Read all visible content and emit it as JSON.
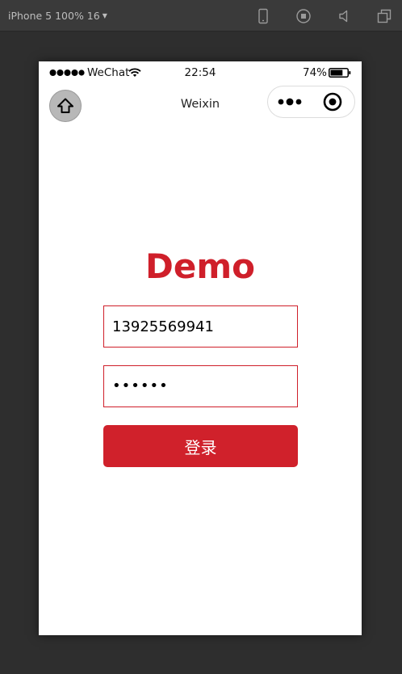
{
  "simulator": {
    "device_label": "iPhone 5 100% 16",
    "toolbar_icons": [
      "phone-icon",
      "record-icon",
      "speaker-icon",
      "windows-icon"
    ]
  },
  "statusbar": {
    "carrier": "WeChat",
    "time": "22:54",
    "battery_percent": "74%",
    "battery_level": 0.74
  },
  "navbar": {
    "title": "Weixin",
    "icons": [
      "home-icon",
      "more-icon",
      "close-icon"
    ]
  },
  "page": {
    "brand_title": "Demo",
    "phone_field_value": "13925569941",
    "password_field_display": "••••••",
    "login_button_label": "登录"
  },
  "colors": {
    "accent": "#cf1f2a",
    "button": "#d0212b"
  }
}
